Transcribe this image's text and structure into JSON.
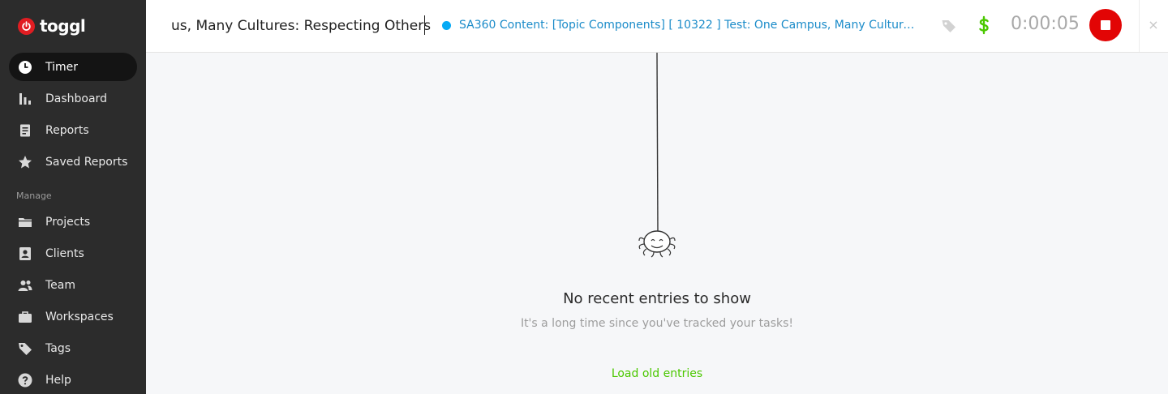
{
  "app": {
    "brand": "toggl",
    "brand_color": "#e11d22"
  },
  "sidebar": {
    "items": [
      {
        "label": "Timer",
        "icon": "clock-icon",
        "active": true
      },
      {
        "label": "Dashboard",
        "icon": "bar-chart-icon"
      },
      {
        "label": "Reports",
        "icon": "document-icon"
      },
      {
        "label": "Saved Reports",
        "icon": "star-icon"
      }
    ],
    "manage_label": "Manage",
    "manage_items": [
      {
        "label": "Projects",
        "icon": "folder-icon"
      },
      {
        "label": "Clients",
        "icon": "contact-card-icon"
      },
      {
        "label": "Team",
        "icon": "people-icon"
      },
      {
        "label": "Workspaces",
        "icon": "briefcase-icon"
      },
      {
        "label": "Tags",
        "icon": "tag-icon"
      },
      {
        "label": "Help",
        "icon": "help-icon"
      }
    ]
  },
  "timer": {
    "description": "us, Many Cultures: Respecting Others",
    "project": "SA360 Content: [Topic Components] [ 10322 ] Test: One Campus, Many Culture...",
    "project_color": "#06aaf5",
    "duration": "0:00:05",
    "billable_color": "#4bc800",
    "stop_color": "#e20505",
    "close_glyph": "×"
  },
  "empty_state": {
    "title": "No recent entries to show",
    "subtitle": "It's a long time since you've tracked your tasks!",
    "load_link": "Load old entries"
  }
}
